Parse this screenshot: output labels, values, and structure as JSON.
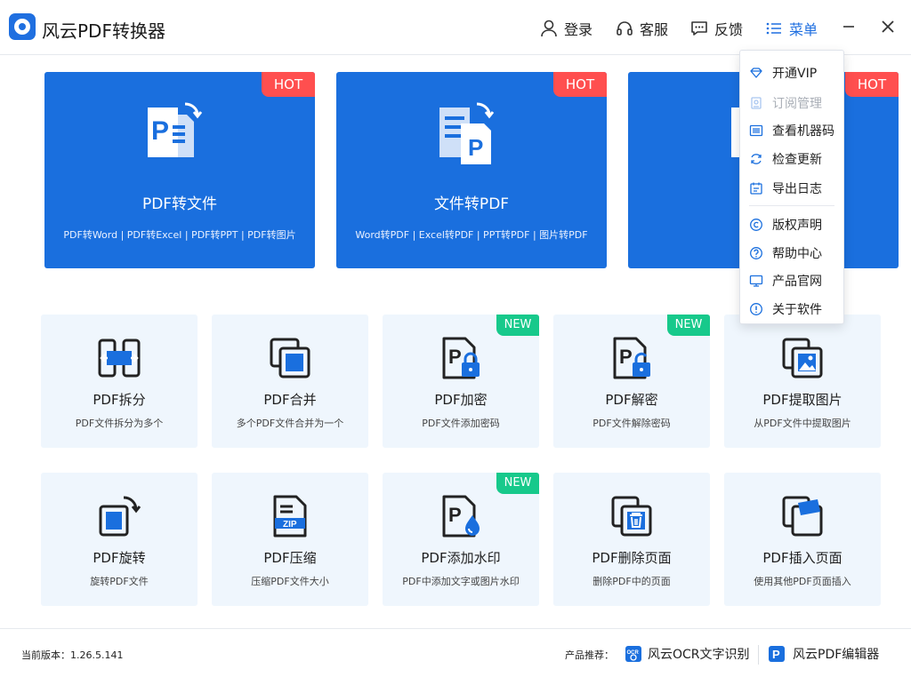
{
  "app": {
    "title": "风云PDF转换器"
  },
  "titlebar": {
    "login": "登录",
    "service": "客服",
    "feedback": "反馈",
    "menu": "菜单"
  },
  "big_cards": [
    {
      "badge": "HOT",
      "title": "PDF转文件",
      "subtitle": "PDF转Word | PDF转Excel | PDF转PPT | PDF转图片"
    },
    {
      "badge": "HOT",
      "title": "文件转PDF",
      "subtitle": "Word转PDF | Excel转PDF | PPT转PDF | 图片转PDF"
    },
    {
      "badge": "HOT",
      "title": "PDF",
      "subtitle": "从PDF文"
    }
  ],
  "tools_row1": [
    {
      "title": "PDF拆分",
      "desc": "PDF文件拆分为多个",
      "badge": ""
    },
    {
      "title": "PDF合并",
      "desc": "多个PDF文件合并为一个",
      "badge": ""
    },
    {
      "title": "PDF加密",
      "desc": "PDF文件添加密码",
      "badge": "NEW"
    },
    {
      "title": "PDF解密",
      "desc": "PDF文件解除密码",
      "badge": "NEW"
    },
    {
      "title": "PDF提取图片",
      "desc": "从PDF文件中提取图片",
      "badge": ""
    }
  ],
  "tools_row2": [
    {
      "title": "PDF旋转",
      "desc": "旋转PDF文件",
      "badge": ""
    },
    {
      "title": "PDF压缩",
      "desc": "压缩PDF文件大小",
      "badge": ""
    },
    {
      "title": "PDF添加水印",
      "desc": "PDF中添加文字或图片水印",
      "badge": "NEW"
    },
    {
      "title": "PDF删除页面",
      "desc": "删除PDF中的页面",
      "badge": ""
    },
    {
      "title": "PDF插入页面",
      "desc": "使用其他PDF页面插入",
      "badge": ""
    }
  ],
  "menu": {
    "items": [
      {
        "label": "开通VIP",
        "icon": "diamond-icon",
        "disabled": false
      },
      {
        "label": "订阅管理",
        "icon": "subscription-icon",
        "disabled": true
      },
      {
        "label": "查看机器码",
        "icon": "barcode-icon",
        "disabled": false
      },
      {
        "label": "检查更新",
        "icon": "refresh-icon",
        "disabled": false
      },
      {
        "label": "导出日志",
        "icon": "log-icon",
        "disabled": false
      },
      {
        "label": "版权声明",
        "icon": "copyright-icon",
        "disabled": false
      },
      {
        "label": "帮助中心",
        "icon": "help-icon",
        "disabled": false
      },
      {
        "label": "产品官网",
        "icon": "monitor-icon",
        "disabled": false
      },
      {
        "label": "关于软件",
        "icon": "info-icon",
        "disabled": false
      }
    ]
  },
  "footer": {
    "version": "当前版本：1.26.5.141",
    "recommend": "产品推荐：",
    "apps": [
      "风云OCR文字识别",
      "风云PDF编辑器"
    ]
  },
  "colors": {
    "accent": "#1a6fde",
    "hot": "#ff4f4f",
    "new": "#17c98b",
    "card_bg": "#eff6fd"
  }
}
